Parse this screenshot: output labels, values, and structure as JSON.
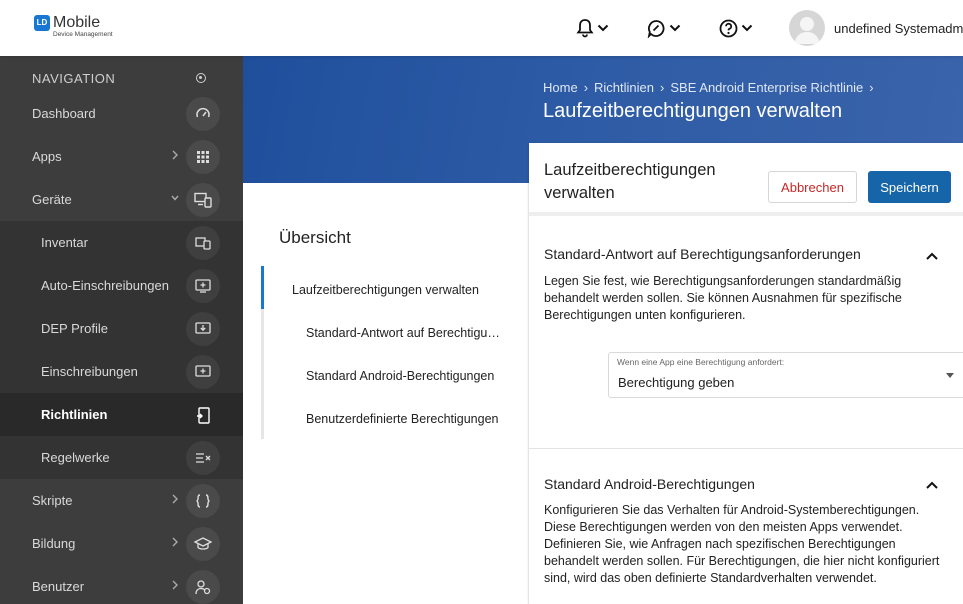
{
  "app": {
    "logo_badge": "LD",
    "logo_title": "Mobile",
    "logo_sub": "Device Management",
    "username": "undefined Systemadmi..."
  },
  "sidebar": {
    "header": "NAVIGATION",
    "items": [
      {
        "label": "Dashboard",
        "icon": "dashboard-icon"
      },
      {
        "label": "Apps",
        "icon": "apps-grid-icon"
      },
      {
        "label": "Geräte",
        "icon": "devices-icon"
      },
      {
        "label": "Inventar",
        "icon": "inventory-icon"
      },
      {
        "label": "Auto-Einschreibungen",
        "icon": "auto-enroll-icon"
      },
      {
        "label": "DEP Profile",
        "icon": "dep-profile-icon"
      },
      {
        "label": "Einschreibungen",
        "icon": "enrollment-icon"
      },
      {
        "label": "Richtlinien",
        "icon": "policy-icon"
      },
      {
        "label": "Regelwerke",
        "icon": "ruleset-icon"
      },
      {
        "label": "Skripte",
        "icon": "script-icon"
      },
      {
        "label": "Bildung",
        "icon": "education-icon"
      },
      {
        "label": "Benutzer",
        "icon": "users-icon"
      }
    ]
  },
  "breadcrumb": {
    "home": "Home",
    "policies": "Richtlinien",
    "policy": "SBE Android Enterprise Richtlinie"
  },
  "page_title": "Laufzeitberechtigungen verwalten",
  "overview": {
    "title": "Übersicht",
    "items": [
      "Laufzeitberechtigungen verwalten",
      "Standard-Antwort auf Berechtigungsanforderungen",
      "Standard Android-Berechtigungen",
      "Benutzerdefinierte Berechtigungen"
    ]
  },
  "card": {
    "title": "Laufzeitberechtigungen verwalten",
    "cancel_label": "Abbrechen",
    "save_label": "Speichern",
    "section1": {
      "title": "Standard-Antwort auf Berechtigungsanforderungen",
      "description": "Legen Sie fest, wie Berechtigungsanforderungen standardmäßig behandelt werden sollen. Sie können Ausnahmen für spezifische Berechtigungen unten konfigurieren.",
      "select_label": "Wenn eine App eine Berechtigung anfordert:",
      "select_value": "Berechtigung geben"
    },
    "section2": {
      "title": "Standard Android-Berechtigungen",
      "description": "Konfigurieren Sie das Verhalten für Android-Systemberechtigungen. Diese Berechtigungen werden von den meisten Apps verwendet. Definieren Sie, wie Anfragen nach spezifischen Berechtigungen behandelt werden sollen. Für Berechtigungen, die hier nicht konfiguriert sind, wird das oben definierte Standardverhalten verwendet."
    }
  },
  "colors": {
    "accent": "#1976d2",
    "save": "#1565a8",
    "cancel_text": "#c62828",
    "sidebar": "#3d3d3d",
    "hero": "#2f5ca6"
  }
}
